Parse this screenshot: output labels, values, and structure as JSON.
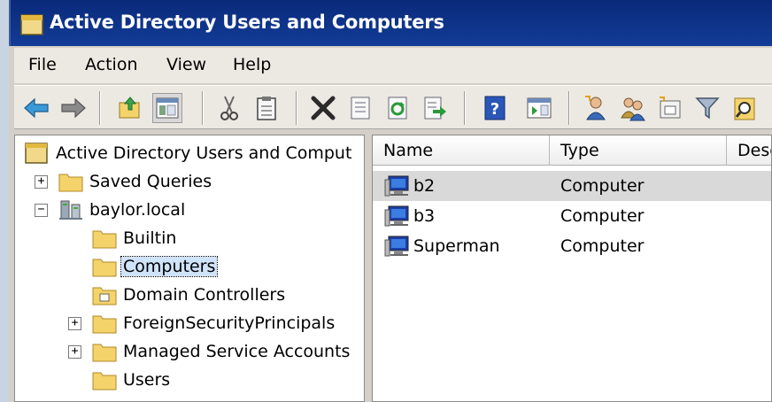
{
  "window": {
    "title": "Active Directory Users and Computers",
    "title_icon": "folder-console-icon"
  },
  "menu": {
    "items": [
      "File",
      "Action",
      "View",
      "Help"
    ]
  },
  "toolbar": {
    "buttons": [
      "back-arrow-icon",
      "forward-arrow-icon",
      "up-folder-icon",
      "show-hide-console-tree-icon",
      "cut-icon",
      "paste-icon",
      "delete-icon",
      "properties-icon",
      "refresh-icon",
      "export-list-icon",
      "help-icon",
      "show-action-pane-icon",
      "new-user-icon",
      "new-group-icon",
      "new-ou-icon",
      "filter-icon",
      "find-icon"
    ]
  },
  "tree": {
    "root": "Active Directory Users and Comput",
    "nodes": [
      {
        "label": "Saved Queries",
        "expander": "+",
        "icon": "folder-icon"
      },
      {
        "label": "baylor.local",
        "expander": "−",
        "icon": "domain-icon"
      },
      {
        "label": "Builtin",
        "icon": "folder-icon"
      },
      {
        "label": "Computers",
        "icon": "folder-icon",
        "selected": true
      },
      {
        "label": "Domain Controllers",
        "icon": "ou-folder-icon"
      },
      {
        "label": "ForeignSecurityPrincipals",
        "expander": "+",
        "icon": "folder-icon"
      },
      {
        "label": "Managed Service Accounts",
        "expander": "+",
        "icon": "folder-icon"
      },
      {
        "label": "Users",
        "icon": "folder-icon"
      }
    ]
  },
  "list": {
    "columns": [
      "Name",
      "Type",
      "Desc"
    ],
    "rows": [
      {
        "name": "b2",
        "type": "Computer",
        "highlighted": true
      },
      {
        "name": "b3",
        "type": "Computer"
      },
      {
        "name": "Superman",
        "type": "Computer"
      }
    ]
  },
  "colors": {
    "titlebar": "#0a2a7a",
    "selection": "#cfe3fb",
    "row_highlight": "#d9d9d9",
    "folder": "#f4d36b"
  }
}
